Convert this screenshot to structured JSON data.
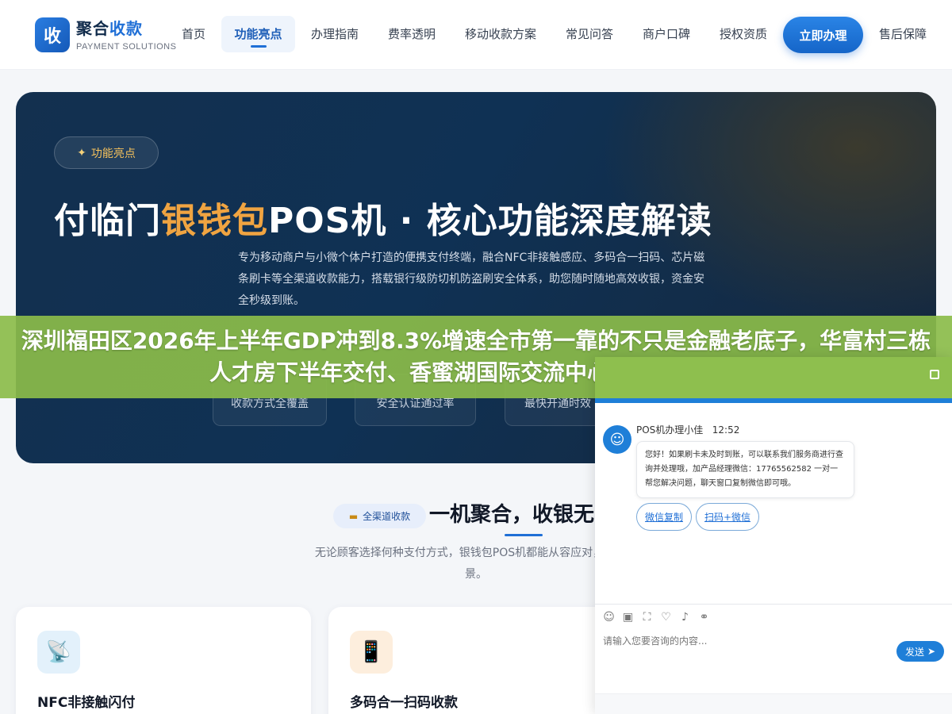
{
  "header": {
    "logo_char": "收",
    "brand_main": "聚合",
    "brand_accent": "收款",
    "brand_sub": "PAYMENT SOLUTIONS",
    "nav": [
      "首页",
      "功能亮点",
      "办理指南",
      "费率透明",
      "移动收款方案",
      "常见问答",
      "商户口碑",
      "授权资质"
    ],
    "active_nav": "功能亮点",
    "cta": "立即办理",
    "after_sales": "售后保障"
  },
  "hero": {
    "badge": "功能亮点",
    "badge_icon": "sparkle-icon",
    "title_prefix": "付临门",
    "title_accent": "银钱包",
    "title_suffix": "POS机 · 核心功能深度解读",
    "description": "专为移动商户与小微个体户打造的便携支付终端，融合NFC非接触感应、多码合一扫码、芯片磁条刷卡等全渠道收款能力，搭载银行级防切机防盗刷安全体系，助您随时随地高效收银，资金安全秒级到账。",
    "stats": [
      "收款方式全覆盖",
      "安全认证通过率",
      "最快开通时效"
    ]
  },
  "banner": {
    "text": "深圳福田区2026年上半年GDP冲到8.3%增速全市第一靠的不只是金融老底子，华富村三栋人才房下半年交付、香蜜湖国际交流中心建成运营、新"
  },
  "section": {
    "tag": "全渠道收款",
    "tag_icon": "card-icon",
    "title": "一机聚合，收银无",
    "desc": "无论顾客选择何种支付方式，银钱包POS机都能从容应对，覆盖当",
    "desc_tail": "景。"
  },
  "cards": [
    {
      "title": "NFC非接触闪付",
      "icon": "nfc-icon"
    },
    {
      "title": "多码合一扫码收款",
      "icon": "phone-icon"
    }
  ],
  "chat": {
    "agent": "POS机办理小佳",
    "time": "12:52",
    "message": "您好！如果刷卡未及时到账，可以联系我们服务商进行查询并处理哦，加产品经理微信：17765562582 一对一帮您解决问题，聊天窗口复制微信即可哦。",
    "buttons": [
      "微信复制",
      "扫码+微信"
    ],
    "input_placeholder": "请输入您要咨询的内容...",
    "send": "发送"
  },
  "colors": {
    "accent": "#1f6fd6",
    "gold": "#f0a441",
    "banner": "#8bbc4a",
    "hero_bg": "#0f3154"
  }
}
